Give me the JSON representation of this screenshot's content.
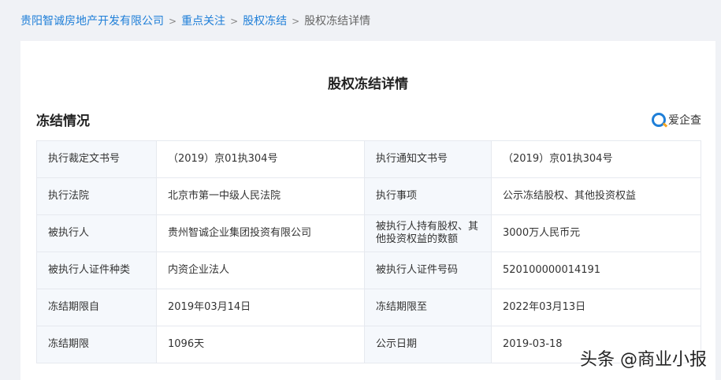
{
  "breadcrumb": [
    "贵阳智诚房地产开发有限公司",
    "重点关注",
    "股权冻结",
    "股权冻结详情"
  ],
  "breadcrumb_sep": ">",
  "page_title": "股权冻结详情",
  "section_title": "冻结情况",
  "logo_text": "爱企查",
  "rows": [
    [
      "执行裁定文书号",
      "（2019）京01执304号",
      "执行通知文书号",
      "（2019）京01执304号"
    ],
    [
      "执行法院",
      "北京市第一中级人民法院",
      "执行事项",
      "公示冻结股权、其他投资权益"
    ],
    [
      "被执行人",
      "贵州智诚企业集团投资有限公司",
      "被执行人持有股权、其他投资权益的数额",
      "3000万人民币元"
    ],
    [
      "被执行人证件种类",
      "内资企业法人",
      "被执行人证件号码",
      "520100000014191"
    ],
    [
      "冻结期限自",
      "2019年03月14日",
      "冻结期限至",
      "2022年03月13日"
    ],
    [
      "冻结期限",
      "1096天",
      "公示日期",
      "2019-03-18"
    ]
  ],
  "watermark": "头条 @商业小报"
}
